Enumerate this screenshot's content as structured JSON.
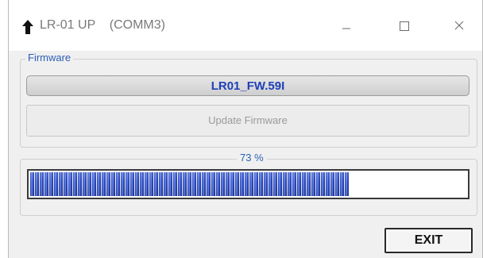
{
  "window": {
    "title": "LR-01 UP    (COMM3)",
    "icon": "up-arrow-icon",
    "controls": [
      "minimize-icon",
      "maximize-icon",
      "close-icon"
    ]
  },
  "firmware_group": {
    "legend": "Firmware",
    "file_name": "LR01_FW.59I",
    "update_label": "Update Firmware"
  },
  "progress": {
    "label": "73 %",
    "value": 73
  },
  "footer": {
    "exit_label": "EXIT"
  },
  "colors": {
    "accent_text": "#2b5fb8",
    "file_text": "#1f3fb8",
    "progress_fill": "#2b4cc4",
    "disabled_text": "#9a9a9a"
  }
}
